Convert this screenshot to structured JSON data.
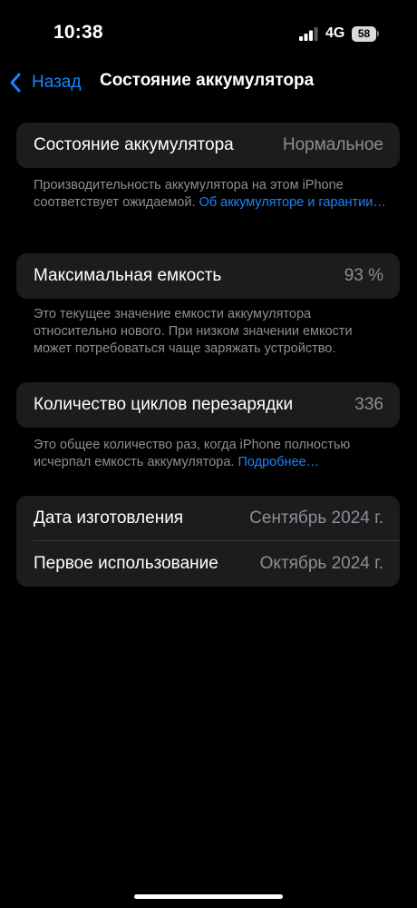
{
  "status_bar": {
    "time": "10:38",
    "network": "4G",
    "battery": "58"
  },
  "nav": {
    "back_label": "Назад",
    "title": "Состояние аккумулятора"
  },
  "health": {
    "label": "Состояние аккумулятора",
    "value": "Нормальное",
    "footnote": "Производительность аккумулятора на этом iPhone соответствует ожидаемой. ",
    "link": "Об аккумуляторе и гарантии…"
  },
  "capacity": {
    "label": "Максимальная емкость",
    "value": "93 %",
    "footnote": "Это текущее значение емкости аккумулятора относительно нового. При низком значении емкости может потребоваться чаще заряжать устройство."
  },
  "cycles": {
    "label": "Количество циклов перезарядки",
    "value": "336",
    "footnote": "Это общее количество раз, когда iPhone полностью исчерпал емкость аккумулятора. ",
    "link": "Подробнее…"
  },
  "dates": {
    "manufacture_label": "Дата изготовления",
    "manufacture_value": "Сентябрь 2024 г.",
    "first_use_label": "Первое использование",
    "first_use_value": "Октябрь 2024 г."
  },
  "colors": {
    "accent": "#1a84ff",
    "background": "#000000",
    "cell": "#1c1c1e",
    "secondary": "#8e8e93"
  }
}
